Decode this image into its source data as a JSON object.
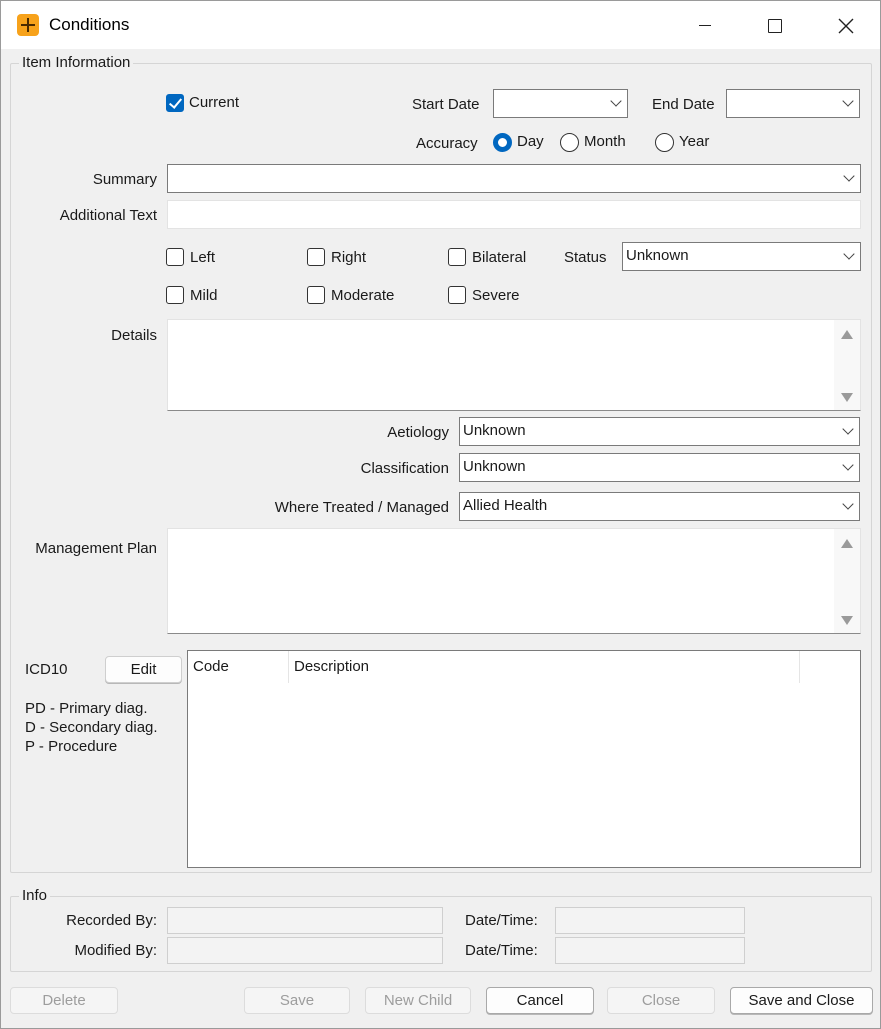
{
  "window": {
    "title": "Conditions",
    "icon": "orange-plus-app-icon"
  },
  "item_information": {
    "legend": "Item Information",
    "current": {
      "label": "Current",
      "checked": true
    },
    "start_date": {
      "label": "Start Date",
      "value": ""
    },
    "end_date": {
      "label": "End Date",
      "value": ""
    },
    "accuracy": {
      "label": "Accuracy",
      "options": [
        "Day",
        "Month",
        "Year"
      ],
      "selected": "Day"
    },
    "summary": {
      "label": "Summary",
      "value": ""
    },
    "additional_text": {
      "label": "Additional Text",
      "value": ""
    },
    "laterality": {
      "left": "Left",
      "right": "Right",
      "bilateral": "Bilateral"
    },
    "severity": {
      "mild": "Mild",
      "moderate": "Moderate",
      "severe": "Severe"
    },
    "status": {
      "label": "Status",
      "value": "Unknown"
    },
    "details": {
      "label": "Details",
      "value": ""
    },
    "aetiology": {
      "label": "Aetiology",
      "value": "Unknown"
    },
    "classification": {
      "label": "Classification",
      "value": "Unknown"
    },
    "where_treated": {
      "label": "Where Treated / Managed",
      "value": "Allied Health"
    },
    "management_plan": {
      "label": "Management Plan",
      "value": ""
    },
    "icd10": {
      "label": "ICD10",
      "edit_label": "Edit",
      "legend_lines": [
        "PD - Primary diag.",
        "D - Secondary diag.",
        "P - Procedure"
      ],
      "columns": [
        "Code",
        "Description"
      ],
      "rows": []
    }
  },
  "info": {
    "legend": "Info",
    "recorded_by": {
      "label": "Recorded By:",
      "value": ""
    },
    "recorded_datetime": {
      "label": "Date/Time:",
      "value": ""
    },
    "modified_by": {
      "label": "Modified By:",
      "value": ""
    },
    "modified_datetime": {
      "label": "Date/Time:",
      "value": ""
    }
  },
  "buttons": {
    "delete": "Delete",
    "save": "Save",
    "new_child": "New Child",
    "cancel": "Cancel",
    "close": "Close",
    "save_and_close": "Save and Close"
  }
}
